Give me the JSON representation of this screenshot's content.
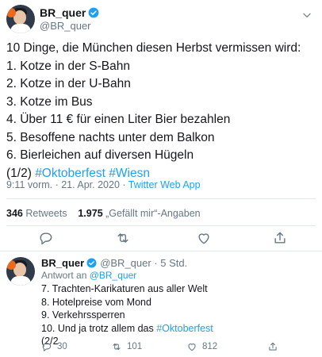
{
  "main_tweet": {
    "display_name": "BR_quer",
    "handle": "@BR_quer",
    "lines": [
      "10 Dinge, die München diesen Herbst vermissen wird:",
      "1. Kotze in der S-Bahn",
      "2. Kotze in der U-Bahn",
      "3. Kotze im Bus",
      "4. Über 11 € für einen Liter Bier bezahlen",
      "5. Besoffene nachts unter dem Balkon",
      "6. Bierleichen auf diversen Hügeln"
    ],
    "last_line_prefix": "(1/2) ",
    "hashtags": [
      "#Oktoberfest",
      "#Wiesn"
    ],
    "timestamp": "9:11 vorm. · 21. Apr. 2020 · ",
    "source": "Twitter Web App",
    "retweets_count": "346",
    "retweets_label": "Retweets",
    "likes_count": "1.975",
    "likes_label": "„Gefällt mir“-Angaben"
  },
  "reply_tweet": {
    "display_name": "BR_quer",
    "handle_time": "@BR_quer · 5 Std.",
    "reply_to_label": "Antwort an ",
    "reply_to_handle": "@BR_quer",
    "lines": [
      "7. Trachten-Karikaturen aus aller Welt",
      "8. Hotelpreise vom Mond",
      "9. Verkehrssperren"
    ],
    "line10_prefix": "10. Und ja trotz allem das ",
    "line10_hashtag": "#Oktoberfest",
    "last_line": "(2/2",
    "reply_count": "30",
    "retweet_count": "101",
    "like_count": "812"
  },
  "colors": {
    "accent": "#1da1f2",
    "muted": "#657786",
    "text": "#14171a"
  },
  "icons": [
    "verified-icon",
    "chevron-down-icon",
    "reply-icon",
    "retweet-icon",
    "like-icon",
    "share-icon"
  ]
}
